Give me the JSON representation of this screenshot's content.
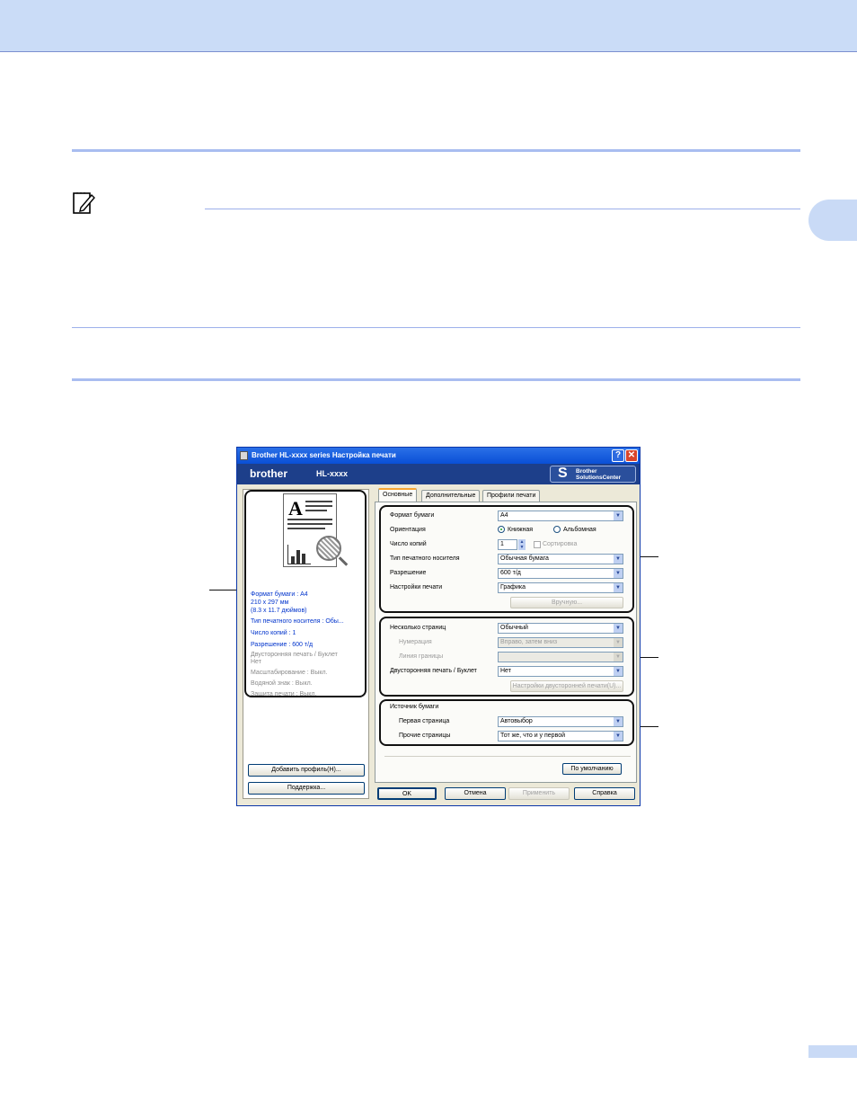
{
  "dialog": {
    "title": "Brother HL-xxxx series Настройка печати",
    "help_btn": "?",
    "close_btn": "✕",
    "brand": "brother",
    "model": "HL-xxxx",
    "solutions_center_line1": "Brother",
    "solutions_center_line2": "SolutionsCenter",
    "solutions_s": "S"
  },
  "summary": {
    "preview_letter": "A",
    "items": [
      "Формат бумаги : A4",
      "210 x 297 мм",
      "(8.3 x 11.7 дюймов)",
      "Тип печатного носителя : Обы...",
      "Число копий : 1",
      "Разрешение : 600 т/д",
      "Двусторонняя печать / Буклет",
      "Нет",
      "Масштабирование : Выкл.",
      "Водяной знак : Выкл.",
      "Защита печати : Выкл."
    ],
    "add_profile_btn": "Добавить профиль(H)...",
    "support_btn": "Поддержка..."
  },
  "tabs": [
    "Основные",
    "Дополнительные",
    "Профили печати"
  ],
  "basic": {
    "paper_size_label": "Формат бумаги",
    "paper_size_value": "A4",
    "orientation_label": "Ориентация",
    "portrait": "Книжная",
    "landscape": "Альбомная",
    "copies_label": "Число копий",
    "copies_value": "1",
    "collate": "Сортировка",
    "media_label": "Тип печатного носителя",
    "media_value": "Обычная бумага",
    "resolution_label": "Разрешение",
    "resolution_value": "600 т/д",
    "settings_label": "Настройки печати",
    "settings_value": "Графика",
    "manual_btn": "Вручную...",
    "multipage_label": "Несколько страниц",
    "multipage_value": "Обычный",
    "order_label": "Нумерация",
    "order_value": "Вправо, затем вниз",
    "border_label": "Линия границы",
    "duplex_label": "Двусторонняя печать / Буклет",
    "duplex_value": "Нет",
    "duplex_settings_btn": "Настройки двусторонней печати(U)...",
    "source_title": "Источник бумаги",
    "first_page_label": "Первая страница",
    "first_page_value": "Автовыбор",
    "other_pages_label": "Прочие страницы",
    "other_pages_value": "Тот же, что и у первой",
    "default_btn": "По умолчанию"
  },
  "buttons": {
    "ok": "OK",
    "cancel": "Отмена",
    "apply": "Применить",
    "help": "Справка"
  },
  "colors": {
    "header_band": "#cadcf7",
    "rule": "#a9bdf0",
    "titlebar": "#0a4fd6",
    "link_text": "#0033cc"
  }
}
